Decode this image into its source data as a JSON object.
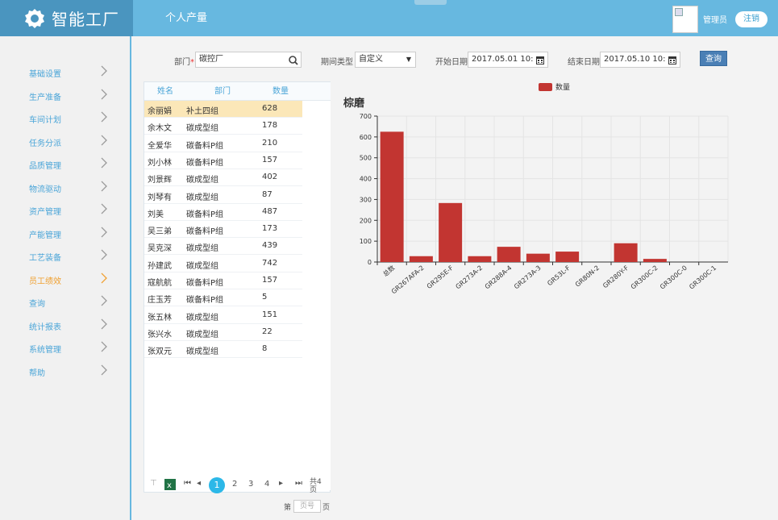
{
  "app": {
    "title": "智能工厂",
    "active_tab": "个人产量",
    "user": "管理员",
    "logout": "注销"
  },
  "sidebar": {
    "items": [
      {
        "label": "基础设置"
      },
      {
        "label": "生产准备"
      },
      {
        "label": "车间计划"
      },
      {
        "label": "任务分派"
      },
      {
        "label": "品质管理"
      },
      {
        "label": "物流驱动"
      },
      {
        "label": "资产管理"
      },
      {
        "label": "产能管理"
      },
      {
        "label": "工艺装备"
      },
      {
        "label": "员工绩效",
        "active": true
      },
      {
        "label": "查询"
      },
      {
        "label": "统计报表"
      },
      {
        "label": "系统管理"
      },
      {
        "label": "帮助"
      }
    ]
  },
  "filter": {
    "dept_label": "部门",
    "dept_required": "*",
    "dept_value": "碳控厂",
    "period_label": "期间类型",
    "period_value": "自定义",
    "start_label": "开始日期",
    "start_value": "2017.05.01 10:10",
    "end_label": "结束日期",
    "end_value": "2017.05.10 10:10",
    "query_label": "查询"
  },
  "table": {
    "headers": [
      "姓名",
      "部门",
      "数量"
    ],
    "rows": [
      [
        "余丽娟",
        "补土四组",
        "628"
      ],
      [
        "余木文",
        "碳成型组",
        "178"
      ],
      [
        "全爱华",
        "碳备料P组",
        "210"
      ],
      [
        "刘小林",
        "碳备料P组",
        "157"
      ],
      [
        "刘景辉",
        "碳成型组",
        "402"
      ],
      [
        "刘琴有",
        "碳成型组",
        "87"
      ],
      [
        "刘美",
        "碳备料P组",
        "487"
      ],
      [
        "吴三弟",
        "碳备料P组",
        "173"
      ],
      [
        "吴克深",
        "碳成型组",
        "439"
      ],
      [
        "孙建武",
        "碳成型组",
        "742"
      ],
      [
        "寇航航",
        "碳备料P组",
        "157"
      ],
      [
        "庄玉芳",
        "碳备料P组",
        "5"
      ],
      [
        "张五林",
        "碳成型组",
        "151"
      ],
      [
        "张兴水",
        "碳成型组",
        "22"
      ],
      [
        "张双元",
        "碳成型组",
        "8"
      ]
    ],
    "selected_row": 0
  },
  "pager": {
    "pages": [
      "1",
      "2",
      "3",
      "4"
    ],
    "current": "1",
    "total": "共4页",
    "goto_prefix": "第",
    "goto_placeholder": "页号",
    "goto_suffix": "页"
  },
  "colors": {
    "header": "#67b8e0",
    "logo_bg": "#4a95bf",
    "bar": "#c23531",
    "sidebar_text": "#4aa5d8",
    "sidebar_active": "#f0a030"
  },
  "chart_data": {
    "type": "bar",
    "title": "棕磨",
    "legend": "数量",
    "legend_position": "top-center",
    "categories": [
      "总数",
      "GR267AFA-2",
      "GR295E-F",
      "GR273A-2",
      "GR288A-4",
      "GR273A-3",
      "GR53L-F",
      "GR80N-2",
      "GR280Y-F",
      "GR300C-2",
      "GR300C-0",
      "GR300C-1"
    ],
    "series": [
      {
        "name": "数量",
        "values": [
          625,
          28,
          283,
          28,
          73,
          40,
          50,
          0,
          90,
          15,
          0,
          0
        ]
      }
    ],
    "ylim": [
      0,
      700
    ],
    "yticks": [
      0,
      100,
      200,
      300,
      400,
      500,
      600,
      700
    ],
    "grid": true
  }
}
